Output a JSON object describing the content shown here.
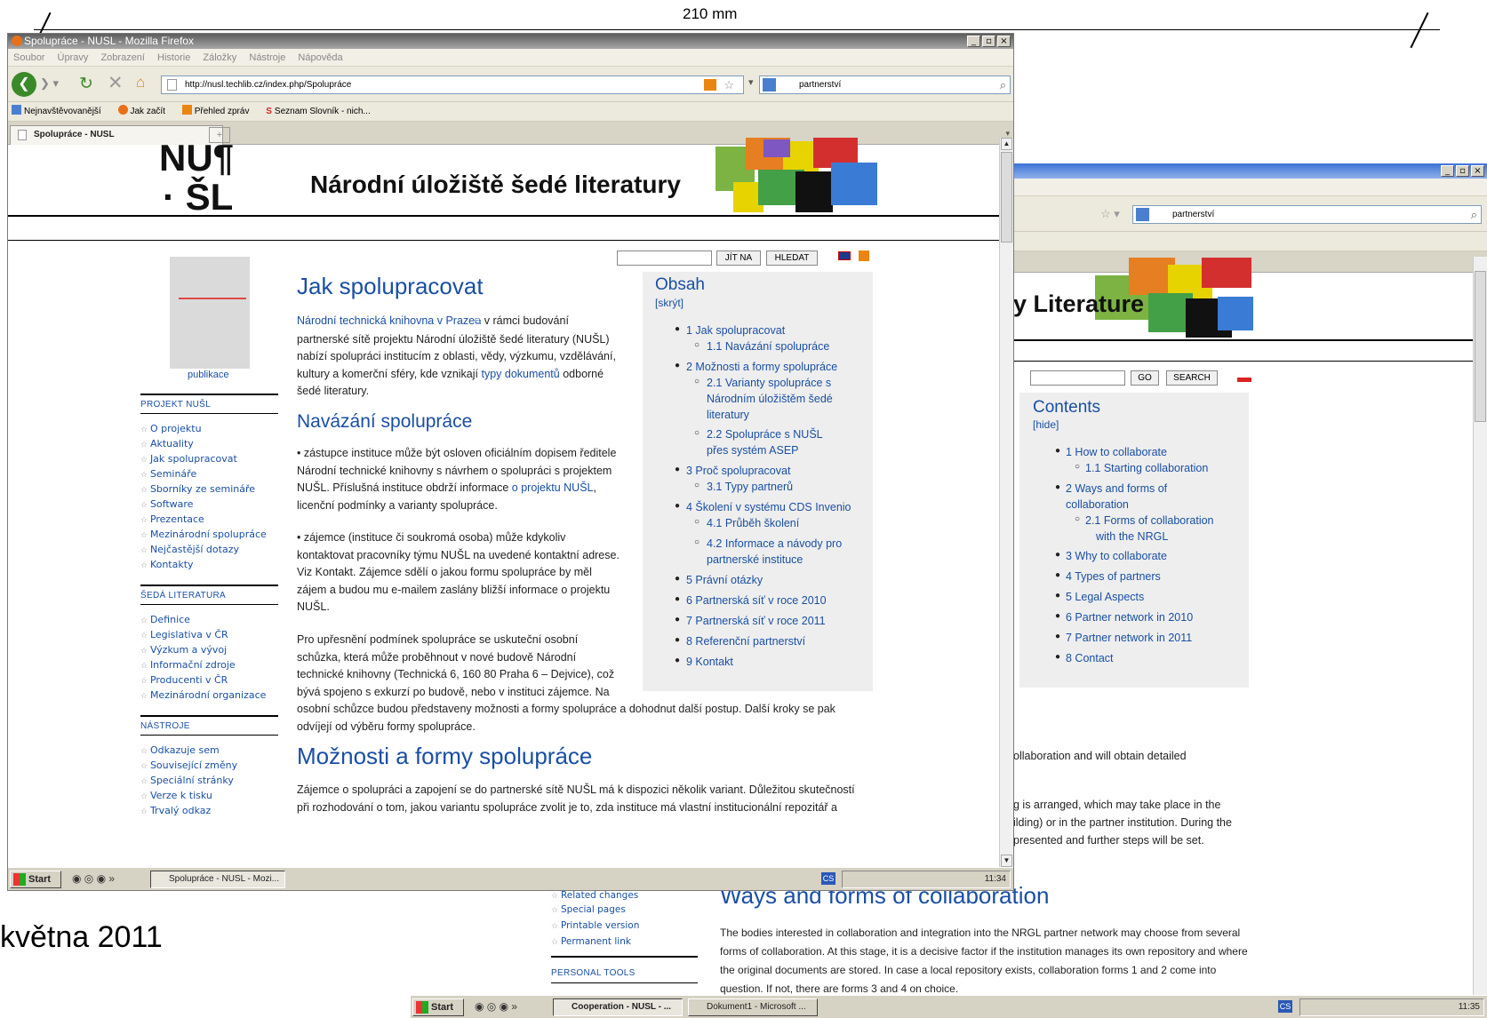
{
  "slide": {
    "dimension": "210 mm",
    "date_fragment": "května 2011"
  },
  "win1": {
    "title": "Spolupráce - NUSL - Mozilla Firefox",
    "menu": [
      "Soubor",
      "Úpravy",
      "Zobrazení",
      "Historie",
      "Záložky",
      "Nástroje",
      "Nápověda"
    ],
    "url": "http://nusl.techlib.cz/index.php/Spolupráce",
    "search": "partnerství",
    "bookmarks": [
      "Nejnavštěvovanější",
      "Jak začít",
      "Přehled zpráv",
      "Seznam Slovník - nich..."
    ],
    "tab": "Spolupráce - NUSL",
    "logo": {
      "top": "NU¶",
      "bottom": "· ŠL"
    },
    "site_title": "Národní úložiště šedé literatury",
    "buttons": {
      "go": "JÍT NA",
      "search": "HLEDAT"
    },
    "cover_caption": "publikace",
    "sidebar": [
      {
        "heading": "PROJEKT NUŠL",
        "items": [
          "O projektu",
          "Aktuality",
          "Jak spolupracovat",
          "Semináře",
          "Sborníky ze semináře",
          "Software",
          "Prezentace",
          "Mezinárodní spolupráce",
          "Nejčastější dotazy",
          "Kontakty"
        ]
      },
      {
        "heading": "ŠEDÁ LITERATURA",
        "items": [
          "Definice",
          "Legislativa v ČR",
          "Výzkum a vývoj",
          "Informační zdroje",
          "Producenti v ČR",
          "Mezinárodní organizace"
        ]
      },
      {
        "heading": "NÁSTROJE",
        "items": [
          "Odkazuje sem",
          "Související změny",
          "Speciální stránky",
          "Verze k tisku",
          "Trvalý odkaz"
        ]
      }
    ],
    "article": {
      "h1": "Jak spolupracovat",
      "intro_link": "Národní technická knihovna v Praze",
      "intro_1": " v rámci budování",
      "intro_2": "partnerské sítě projektu Národní úložiště šedé literatury (NUŠL)",
      "intro_3": "nabízí spolupráci institucím z oblasti, vědy, výzkumu, vzdělávání,",
      "intro_4a": "kultury a komerční sféry, kde vznikají ",
      "intro_4_link": "typy dokumentů",
      "intro_4b": " odborné",
      "intro_5": "šedé literatury.",
      "h2a": "Navázání spolupráce",
      "p1_1": "• zástupce instituce může být osloven oficiálním dopisem ředitele",
      "p1_2": "Národní technické knihovny s návrhem o spolupráci s projektem",
      "p1_3a": "NUŠL. Příslušná instituce obdrží informace ",
      "p1_3_link": "o projektu NUŠL",
      "p1_3b": ",",
      "p1_4": "licenční podmínky a varianty spolupráce.",
      "p2_1": "• zájemce (instituce či soukromá osoba) může kdykoliv",
      "p2_2": "kontaktovat pracovníky týmu NUŠL na uvedené kontaktní adrese.",
      "p2_3": "Viz Kontakt. Zájemce sdělí o jakou formu spolupráce by měl",
      "p2_4": "zájem a budou mu e-mailem zaslány bližší informace o projektu",
      "p2_5": "NUŠL.",
      "p3_1": "Pro upřesnění podmínek spolupráce se uskuteční osobní",
      "p3_2": "schůzka, která může proběhnout v nové budově Národní",
      "p3_3": "technické knihovny (Technická 6, 160 80 Praha 6 – Dejvice), což",
      "p3_4": "bývá spojeno s exkurzí po budově, nebo v instituci zájemce. Na",
      "p3_5": "osobní schůzce budou představeny možnosti a formy spolupráce a dohodnut další postup. Další kroky se pak",
      "p3_6": "odvíjejí od výběru formy spolupráce.",
      "h2b": "Možnosti a formy spolupráce",
      "p4_1": "Zájemce o spolupráci a zapojení se do partnerské sítě NUŠL má k dispozici několik variant. Důležitou skutečností",
      "p4_2": "při rozhodování o tom, jakou variantu spolupráce zvolit je to, zda instituce má vlastní institucionální repozitář a"
    },
    "toc": {
      "title": "Obsah",
      "toggle": "[skrýt]",
      "items": [
        "1 Jak spolupracovat",
        "1.1 Navázání spolupráce",
        "2 Možnosti a formy spolupráce",
        "2.1 Varianty spolupráce s",
        "Národním úložištěm šedé",
        "literatury",
        "2.2 Spolupráce s NUŠL",
        "přes systém ASEP",
        "3 Proč spolupracovat",
        "3.1 Typy partnerů",
        "4 Školení v systému CDS Invenio",
        "4.1 Průběh školení",
        "4.2 Informace a návody pro",
        "partnerské instituce",
        "5 Právní otázky",
        "6 Partnerská síť v roce 2010",
        "7 Partnerská síť v roce 2011",
        "8 Referenční partnerství",
        "9 Kontakt"
      ]
    },
    "taskbar": {
      "start": "Start",
      "task": "Spolupráce - NUSL - Mozi...",
      "lang": "CS",
      "clock": "11:34"
    }
  },
  "win2": {
    "search": "partnerství",
    "site_title_fragment": "y Literature",
    "buttons": {
      "go": "GO",
      "search": "SEARCH"
    },
    "toc": {
      "title": "Contents",
      "toggle": "[hide]",
      "items": [
        "1 How to collaborate",
        "1.1 Starting collaboration",
        "2 Ways and forms of",
        "collaboration",
        "2.1 Forms of collaboration",
        "with the NRGL",
        "3 Why to collaborate",
        "4 Types of partners",
        "5 Legal Aspects",
        "6 Partner network in 2010",
        "7 Partner network in 2011",
        "8 Contact"
      ]
    },
    "frag_1": "ollaboration and will obtain detailed",
    "frag_2": "g is arranged, which may take place in the",
    "frag_3": "ilding) or in the partner institution. During the",
    "frag_4": "presented and further steps will be set."
  },
  "win2_lower": {
    "side_items": [
      "Related changes",
      "Special pages",
      "Printable version",
      "Permanent link"
    ],
    "side_heading": "PERSONAL TOOLS",
    "h2": "Ways and forms of collaboration",
    "p_1": "The bodies interested in collaboration and integration into the NRGL partner network may choose from several",
    "p_2": "forms of collaboration. At this stage, it is a decisive factor if the institution manages its own repository and where",
    "p_3": "the original documents are stored. In case a local repository exists, collaboration forms 1 and 2 come into",
    "p_4": "question. If not, there are forms 3 and 4 on choice.",
    "taskbar": {
      "start": "Start",
      "task1": "Cooperation - NUSL - ...",
      "task2": "Dokument1 - Microsoft ...",
      "lang": "CS",
      "clock": "11:35"
    }
  }
}
